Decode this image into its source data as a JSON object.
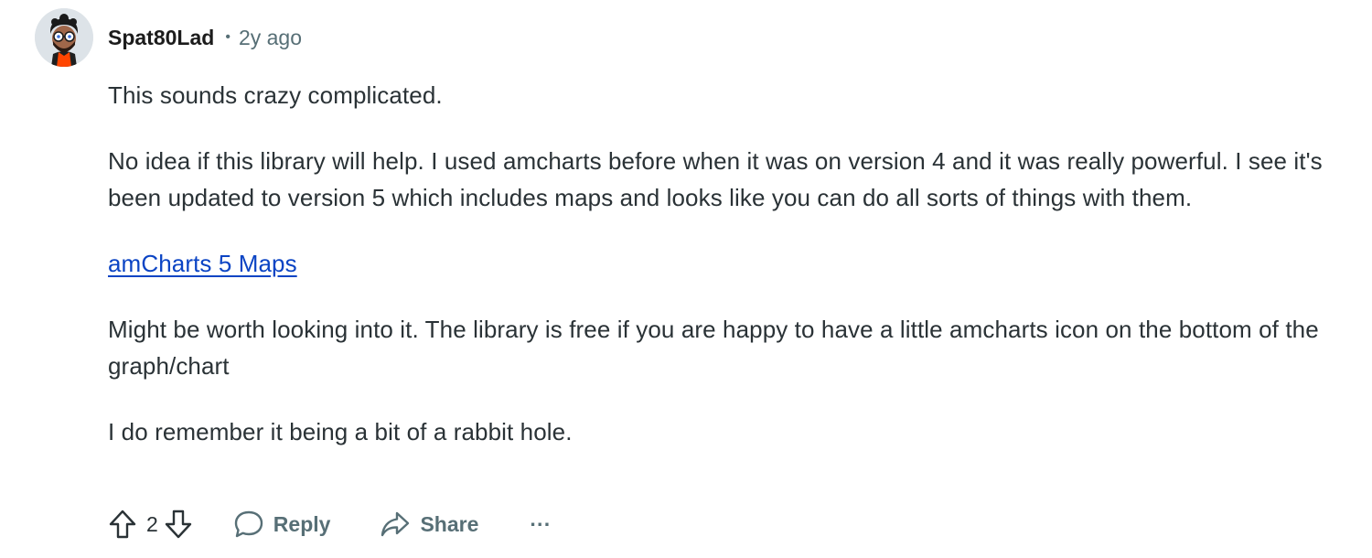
{
  "comment": {
    "author": "Spat80Lad",
    "separator": "•",
    "time": "2y ago",
    "paragraphs": {
      "p1": "This sounds crazy complicated.",
      "p2": "No idea if this library will help. I used amcharts before when it was on version 4 and it was really powerful. I see it's been updated to version 5 which includes maps and looks like you can do all sorts of things with them.",
      "link": "amCharts 5 Maps",
      "p3": "Might be worth looking into it. The library is free if you are happy to have a little amcharts icon on the bottom of the graph/chart",
      "p4": "I do remember it being a bit of a rabbit hole."
    },
    "actions": {
      "score": "2",
      "reply": "Reply",
      "share": "Share",
      "more": "···"
    },
    "icons": {
      "upvote": "upvote-arrow-icon",
      "downvote": "downvote-arrow-icon",
      "reply": "speech-bubble-icon",
      "share": "share-arrow-icon",
      "more": "ellipsis-icon"
    },
    "colors": {
      "text": "#2a3236",
      "meta": "#576f76",
      "link": "#0b44c4"
    }
  }
}
